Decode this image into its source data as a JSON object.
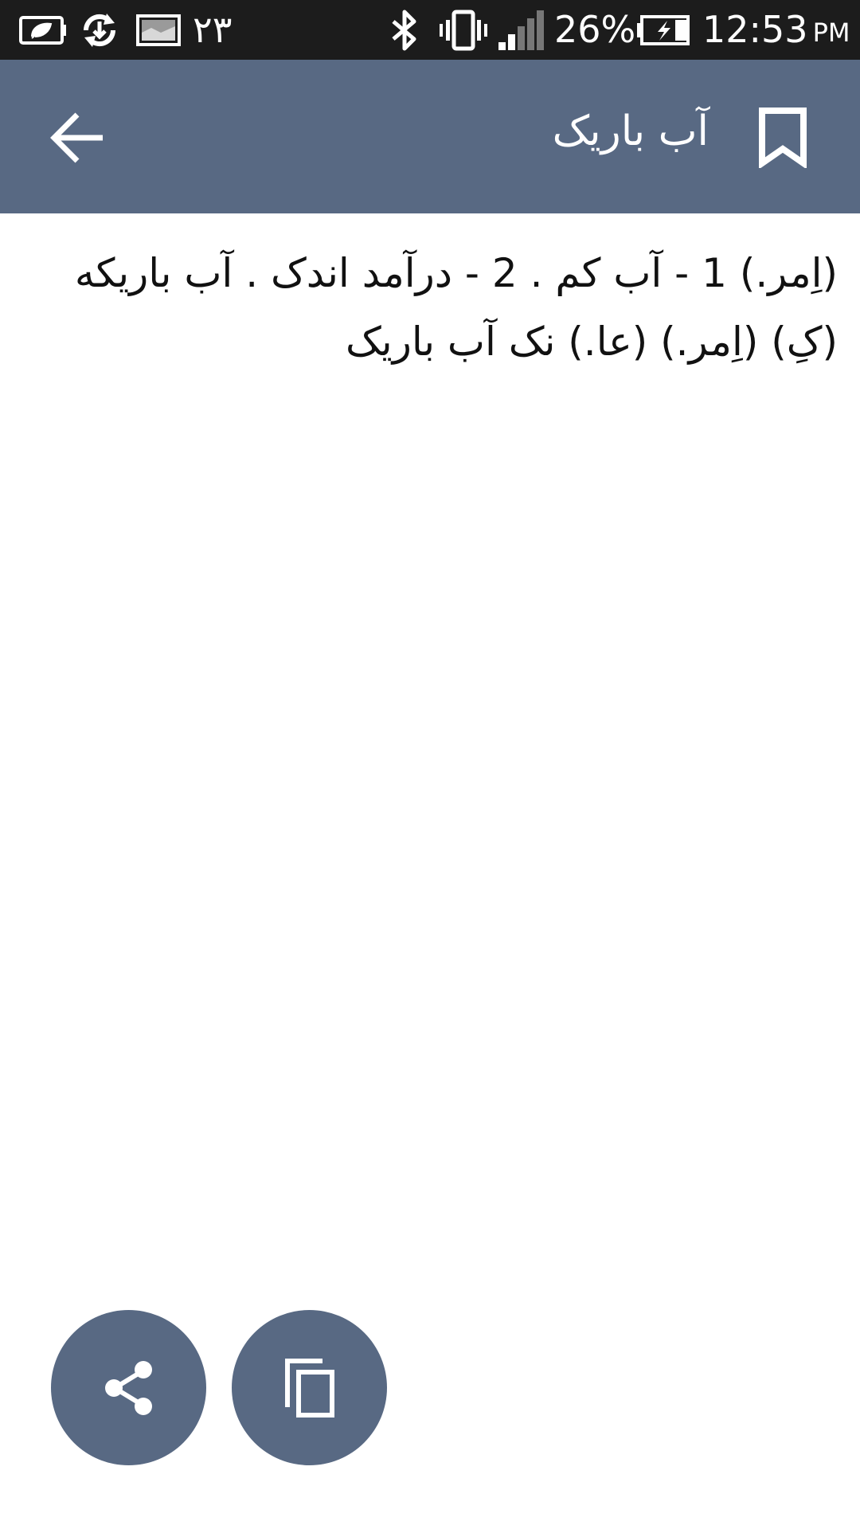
{
  "status_bar": {
    "notification_text": "۲۳",
    "battery_percent": "26%",
    "time": "12:53",
    "ampm": "PM",
    "icons": [
      "eco-battery-icon",
      "sync-download-icon",
      "gallery-icon",
      "bluetooth-icon",
      "vibrate-icon",
      "signal-icon",
      "charging-battery-icon"
    ]
  },
  "app_bar": {
    "title": "آب باریک",
    "back_icon": "arrow-back-icon",
    "bookmark_icon": "bookmark-icon"
  },
  "content": {
    "definition": "(اِمر.) 1 - آب کم . 2 - درآمد اندک . آب باریکه (کِ) (اِمر.) (عا.) نک  آب باریک"
  },
  "actions": {
    "share_icon": "share-icon",
    "copy_icon": "copy-icon"
  },
  "colors": {
    "primary": "#586983",
    "status_bar": "#1c1c1c",
    "background": "#ffffff"
  }
}
